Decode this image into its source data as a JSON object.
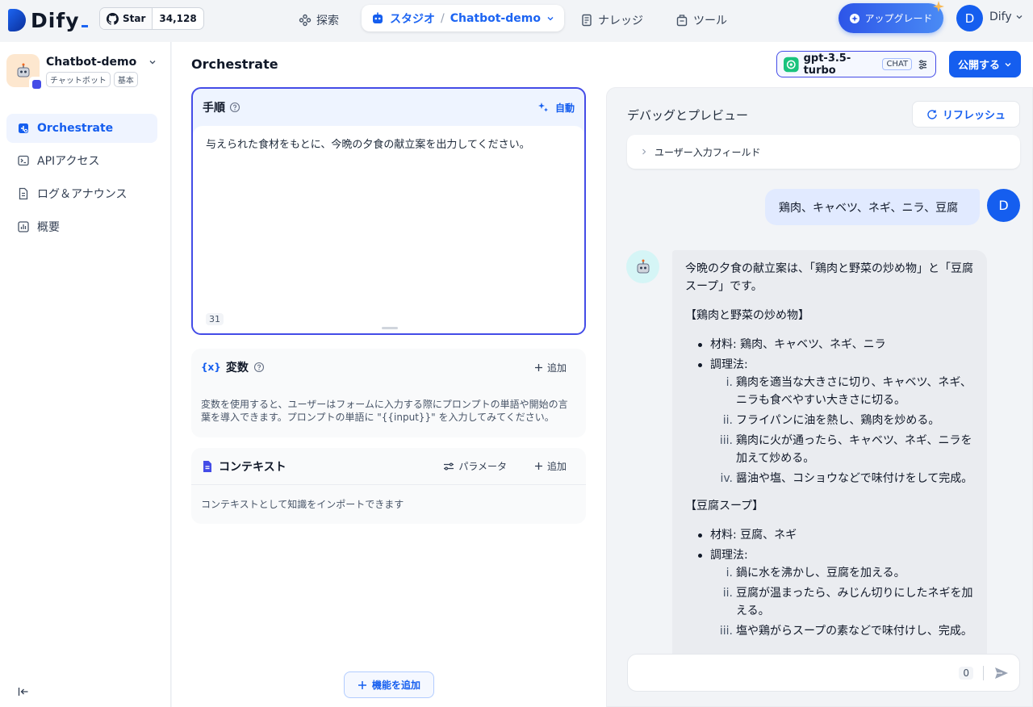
{
  "topbar": {
    "logo_text": "Dify",
    "github_star_label": "Star",
    "github_star_count": "34,128",
    "nav_explore": "探索",
    "nav_studio": "スタジオ",
    "nav_app_name": "Chatbot-demo",
    "nav_knowledge": "ナレッジ",
    "nav_tools": "ツール",
    "upgrade_label": "アップグレード",
    "user_initial": "D",
    "user_name": "Dify"
  },
  "sidebar": {
    "app_name": "Chatbot-demo",
    "app_tags": [
      "チャットボット",
      "基本"
    ],
    "items": [
      {
        "label": "Orchestrate",
        "icon": "orchestrate-icon",
        "active": true
      },
      {
        "label": "APIアクセス",
        "icon": "terminal-icon",
        "active": false
      },
      {
        "label": "ログ＆アナウンス",
        "icon": "document-icon",
        "active": false
      },
      {
        "label": "概要",
        "icon": "chart-icon",
        "active": false
      }
    ]
  },
  "main": {
    "title": "Orchestrate",
    "model_name": "gpt-3.5-turbo",
    "model_badge": "CHAT",
    "publish_label": "公開する",
    "prompt": {
      "title": "手順",
      "auto_label": "自動",
      "text": "与えられた食材をもとに、今晩の夕食の献立案を出力してください。",
      "char_count": "31"
    },
    "variables": {
      "title": "変数",
      "add_label": "追加",
      "description": "変数を使用すると、ユーザーはフォームに入力する際にプロンプトの単語や開始の言葉を導入できます。プロンプトの単語に \"{{input}}\" を入力してみてください。"
    },
    "context": {
      "title": "コンテキスト",
      "params_label": "パラメータ",
      "add_label": "追加",
      "description": "コンテキストとして知識をインポートできます"
    },
    "add_feature_label": "機能を追加"
  },
  "debug": {
    "title": "デバッグとプレビュー",
    "refresh_label": "リフレッシュ",
    "user_input_field_label": "ユーザー入力フィールド",
    "user_message": "鶏肉、キャベツ、ネギ、ニラ、豆腐",
    "user_avatar": "D",
    "answer": {
      "intro": "今晩の夕食の献立案は、「鶏肉と野菜の炒め物」と「豆腐スープ」です。",
      "dish1_title": "【鶏肉と野菜の炒め物】",
      "dish1_materials": "材料: 鶏肉、キャベツ、ネギ、ニラ",
      "dish1_method_label": "調理法:",
      "dish1_steps": [
        {
          "n": "i.",
          "text": "鶏肉を適当な大きさに切り、キャベツ、ネギ、ニラも食べやすい大きさに切る。"
        },
        {
          "n": "ii.",
          "text": "フライパンに油を熱し、鶏肉を炒める。"
        },
        {
          "n": "iii.",
          "text": "鶏肉に火が通ったら、キャベツ、ネギ、ニラを加えて炒める。"
        },
        {
          "n": "iv.",
          "text": "醤油や塩、コショウなどで味付けをして完成。"
        }
      ],
      "dish2_title": "【豆腐スープ】",
      "dish2_materials": "材料: 豆腐、ネギ",
      "dish2_method_label": "調理法:",
      "dish2_steps": [
        {
          "n": "i.",
          "text": "鍋に水を沸かし、豆腐を加える。"
        },
        {
          "n": "ii.",
          "text": "豆腐が温まったら、みじん切りにしたネギを加える。"
        },
        {
          "n": "iii.",
          "text": "塩や鶏がらスープの素などで味付けし、完成。"
        }
      ]
    },
    "input_char_count": "0"
  },
  "colors": {
    "accent": "#155eef",
    "prompt_border": "#444ce7"
  }
}
